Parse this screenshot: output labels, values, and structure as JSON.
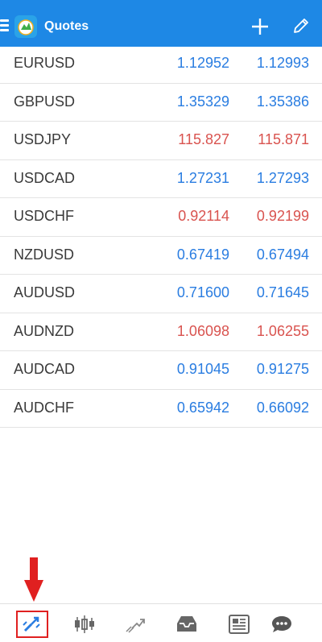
{
  "header": {
    "title": "Quotes",
    "color": "#1e88e5"
  },
  "quotes": [
    {
      "symbol": "EURUSD",
      "bid": "1.12952",
      "ask": "1.12993",
      "direction": "up"
    },
    {
      "symbol": "GBPUSD",
      "bid": "1.35329",
      "ask": "1.35386",
      "direction": "up"
    },
    {
      "symbol": "USDJPY",
      "bid": "115.827",
      "ask": "115.871",
      "direction": "down"
    },
    {
      "symbol": "USDCAD",
      "bid": "1.27231",
      "ask": "1.27293",
      "direction": "up"
    },
    {
      "symbol": "USDCHF",
      "bid": "0.92114",
      "ask": "0.92199",
      "direction": "down"
    },
    {
      "symbol": "NZDUSD",
      "bid": "0.67419",
      "ask": "0.67494",
      "direction": "up"
    },
    {
      "symbol": "AUDUSD",
      "bid": "0.71600",
      "ask": "0.71645",
      "direction": "up"
    },
    {
      "symbol": "AUDNZD",
      "bid": "1.06098",
      "ask": "1.06255",
      "direction": "down"
    },
    {
      "symbol": "AUDCAD",
      "bid": "0.91045",
      "ask": "0.91275",
      "direction": "up"
    },
    {
      "symbol": "AUDCHF",
      "bid": "0.65942",
      "ask": "0.66092",
      "direction": "up"
    }
  ],
  "colors": {
    "up": "#2a7de1",
    "down": "#d9534f",
    "highlight": "#e02020"
  },
  "bottom_nav": [
    {
      "icon": "quotes-icon",
      "active": true
    },
    {
      "icon": "chart-icon",
      "active": false
    },
    {
      "icon": "trade-icon",
      "active": false
    },
    {
      "icon": "history-icon",
      "active": false
    },
    {
      "icon": "news-icon",
      "active": false
    },
    {
      "icon": "messages-icon",
      "active": false
    }
  ]
}
